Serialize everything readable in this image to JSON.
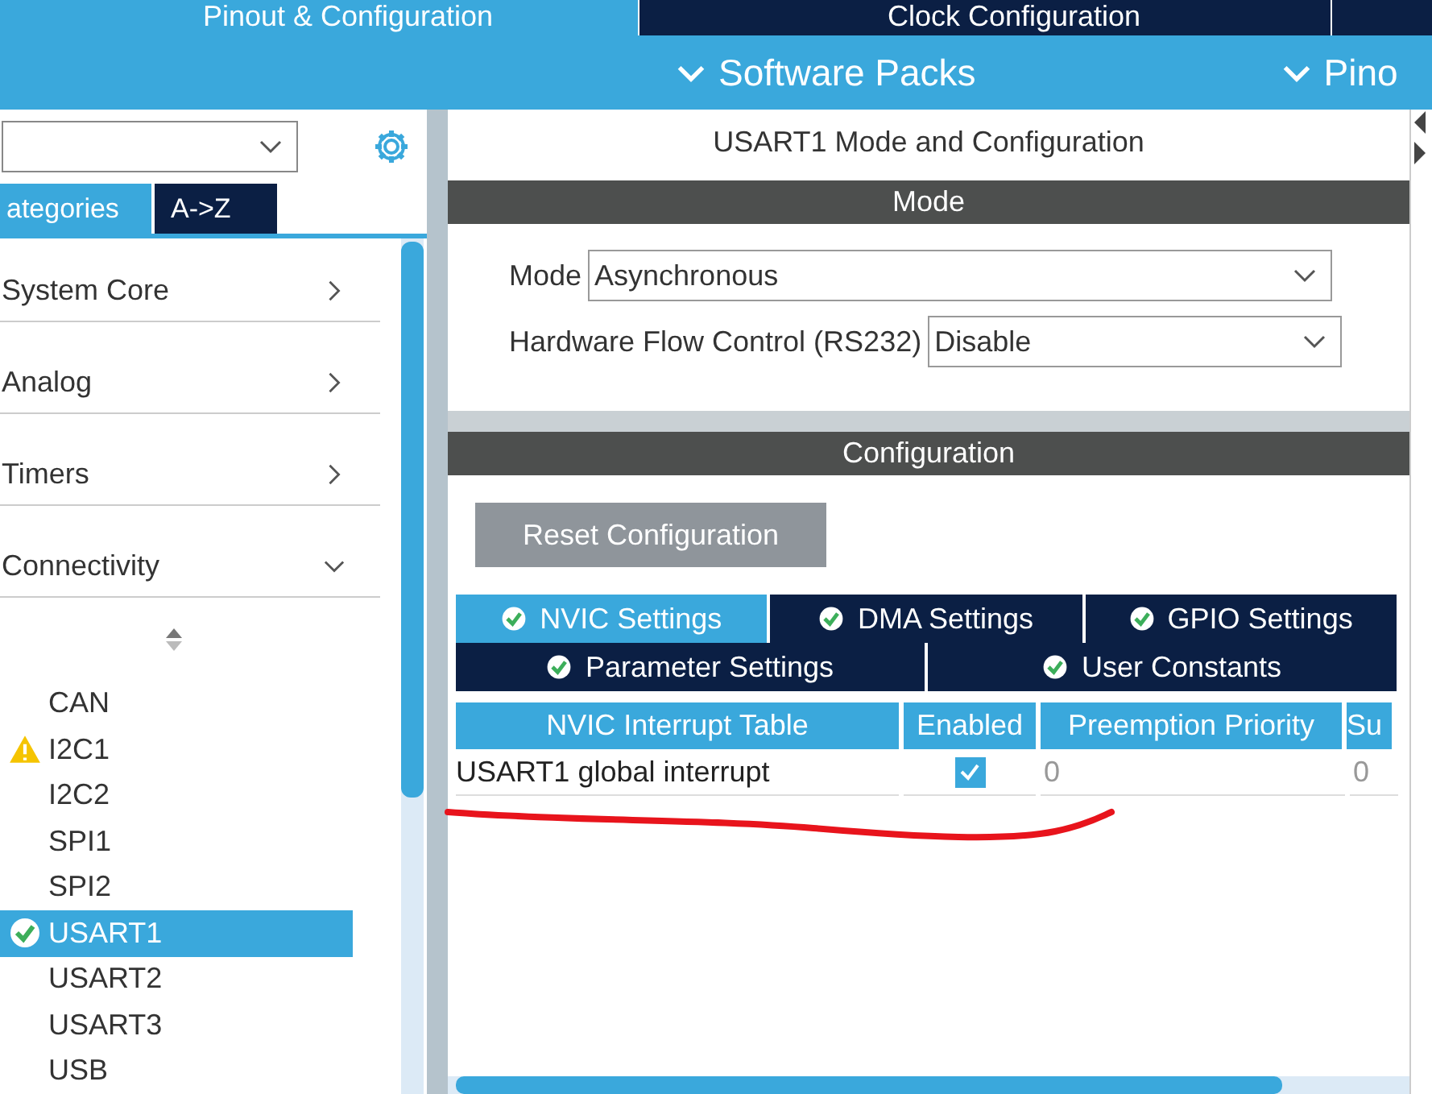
{
  "top_tabs": [
    {
      "label": "Pinout & Configuration",
      "selected": true
    },
    {
      "label": "Clock Configuration",
      "selected": false
    }
  ],
  "menu_bar": [
    {
      "label": "Software Packs"
    },
    {
      "label": "Pino"
    }
  ],
  "sidebar": {
    "view_tabs": [
      {
        "label": "ategories",
        "selected": true
      },
      {
        "label": "A->Z",
        "selected": false
      }
    ],
    "categories": [
      {
        "label": "System Core",
        "expanded": false
      },
      {
        "label": "Analog",
        "expanded": false
      },
      {
        "label": "Timers",
        "expanded": false
      },
      {
        "label": "Connectivity",
        "expanded": true
      }
    ],
    "peripherals": [
      {
        "label": "CAN",
        "kind": "plain",
        "selected": false
      },
      {
        "label": "I2C1",
        "kind": "warning",
        "selected": false
      },
      {
        "label": "I2C2",
        "kind": "plain",
        "selected": false
      },
      {
        "label": "SPI1",
        "kind": "plain",
        "selected": false
      },
      {
        "label": "SPI2",
        "kind": "plain",
        "selected": false
      },
      {
        "label": "USART1",
        "kind": "ok",
        "selected": true
      },
      {
        "label": "USART2",
        "kind": "plain",
        "selected": false
      },
      {
        "label": "USART3",
        "kind": "plain",
        "selected": false
      },
      {
        "label": "USB",
        "kind": "plain",
        "selected": false
      }
    ]
  },
  "panel": {
    "title": "USART1 Mode and Configuration",
    "mode_header": "Mode",
    "mode_fields": [
      {
        "label": "Mode",
        "value": "Asynchronous"
      },
      {
        "label": "Hardware Flow Control (RS232)",
        "value": "Disable"
      }
    ],
    "config_header": "Configuration",
    "reset_button": "Reset Configuration",
    "config_tabs": [
      [
        {
          "label": "NVIC Settings",
          "selected": true
        },
        {
          "label": "DMA Settings",
          "selected": false
        },
        {
          "label": "GPIO Settings",
          "selected": false
        }
      ],
      [
        {
          "label": "Parameter Settings",
          "selected": false
        },
        {
          "label": "User Constants",
          "selected": false
        }
      ]
    ],
    "table": {
      "columns": [
        "NVIC Interrupt Table",
        "Enabled",
        "Preemption Priority",
        "Su"
      ],
      "rows": [
        {
          "name": "USART1 global interrupt",
          "enabled": true,
          "preemption": "0",
          "sub": "0"
        }
      ]
    }
  }
}
